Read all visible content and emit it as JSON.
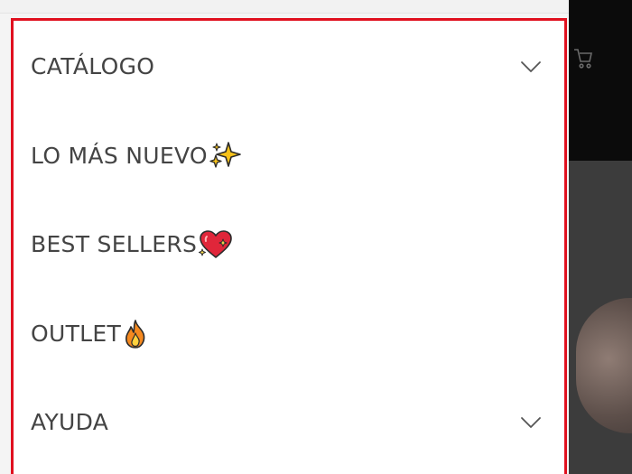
{
  "menu": {
    "items": [
      {
        "label": "CATÁLOGO",
        "has_submenu": true,
        "icon": "chevron-down-icon"
      },
      {
        "label": "LO MÁS NUEVO",
        "emoji": "sparkles-icon"
      },
      {
        "label": "BEST SELLERS",
        "emoji": "sparkling-heart-icon"
      },
      {
        "label": "OUTLET",
        "emoji": "fire-icon"
      },
      {
        "label": "AYUDA",
        "has_submenu": true,
        "icon": "chevron-down-icon"
      }
    ]
  },
  "colors": {
    "drawer_border": "#e0101f",
    "menu_text": "#444444",
    "background_header": "#0b0b0b",
    "background_content": "#3c3c3c"
  }
}
